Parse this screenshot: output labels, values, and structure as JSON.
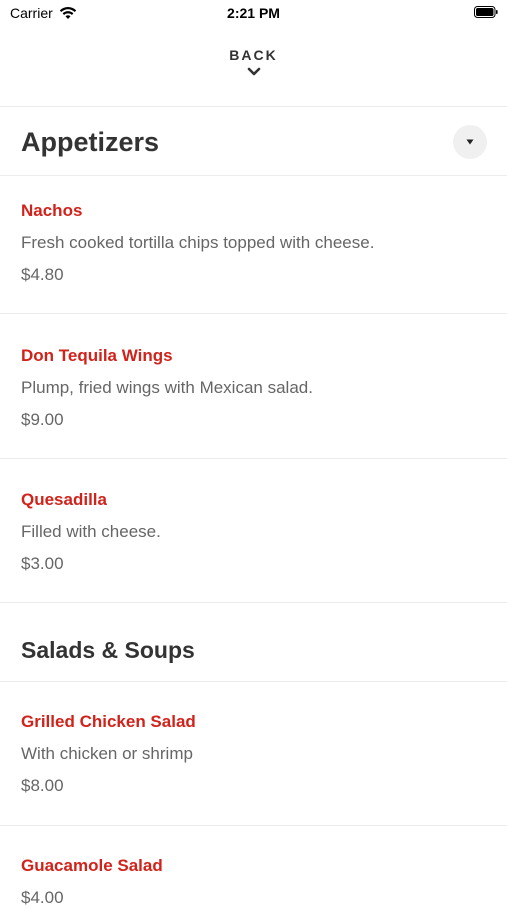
{
  "status_bar": {
    "carrier": "Carrier",
    "time": "2:21 PM"
  },
  "nav": {
    "back_label": "BACK",
    "back_icon": "chevron-down-icon"
  },
  "categories": [
    {
      "title": "Appetizers",
      "collapse_icon": "triangle-down-icon",
      "items": [
        {
          "name": "Nachos",
          "description": "Fresh cooked tortilla chips topped with cheese.",
          "price": "$4.80"
        },
        {
          "name": "Don Tequila Wings",
          "description": "Plump, fried wings with Mexican salad.",
          "price": "$9.00"
        },
        {
          "name": "Quesadilla",
          "description": "Filled with cheese.",
          "price": "$3.00"
        }
      ]
    },
    {
      "title": "Salads & Soups",
      "items": [
        {
          "name": "Grilled Chicken Salad",
          "description": "With chicken or shrimp",
          "price": "$8.00"
        },
        {
          "name": "Guacamole Salad",
          "description": "",
          "price": "$4.00"
        }
      ]
    }
  ],
  "colors": {
    "item_name": "#d0231b",
    "text_secondary": "#666666",
    "divider": "#ececec"
  }
}
